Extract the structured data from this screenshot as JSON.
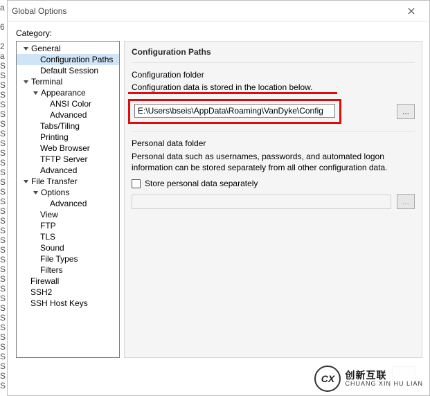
{
  "left_chars": [
    "a",
    "",
    "6",
    "",
    "2",
    "a",
    "S",
    "S",
    "S",
    "S",
    "S",
    "S",
    "S",
    "S",
    "S",
    "S",
    "S",
    "S",
    "S",
    "S",
    "S",
    "S",
    "S",
    "S",
    "S",
    "S",
    "S",
    "S",
    "S",
    "S",
    "S",
    "S",
    "S",
    "S",
    "S",
    "S",
    "S",
    "S",
    "S",
    "S"
  ],
  "title": "Global Options",
  "category_label": "Category:",
  "tree": {
    "general": "General",
    "config_paths": "Configuration Paths",
    "default_session": "Default Session",
    "terminal": "Terminal",
    "appearance": "Appearance",
    "ansi_color": "ANSI Color",
    "adv_appearance": "Advanced",
    "tabs": "Tabs/Tiling",
    "printing": "Printing",
    "web": "Web Browser",
    "tftp": "TFTP Server",
    "adv_term": "Advanced",
    "file_transfer": "File Transfer",
    "options": "Options",
    "adv_ft": "Advanced",
    "view": "View",
    "ftp": "FTP",
    "tls": "TLS",
    "sound": "Sound",
    "file_types": "File Types",
    "filters": "Filters",
    "firewall": "Firewall",
    "ssh2": "SSH2",
    "ssh_host_keys": "SSH Host Keys"
  },
  "panel": {
    "title": "Configuration Paths",
    "cfg_folder_label": "Configuration folder",
    "cfg_folder_desc": "Configuration data is stored in the location below.",
    "cfg_folder_value": "E:\\Users\\bseis\\AppData\\Roaming\\VanDyke\\Config",
    "browse_label": "...",
    "pdata_label": "Personal data folder",
    "pdata_desc": "Personal data such as usernames, passwords, and automated logon information can be stored separately from all other configuration data.",
    "pdata_checkbox": "Store personal data separately",
    "browse2_label": "..."
  },
  "watermark": {
    "logo": "CX",
    "cn": "创新互联",
    "py": "CHUANG XIN HU LIAN"
  }
}
